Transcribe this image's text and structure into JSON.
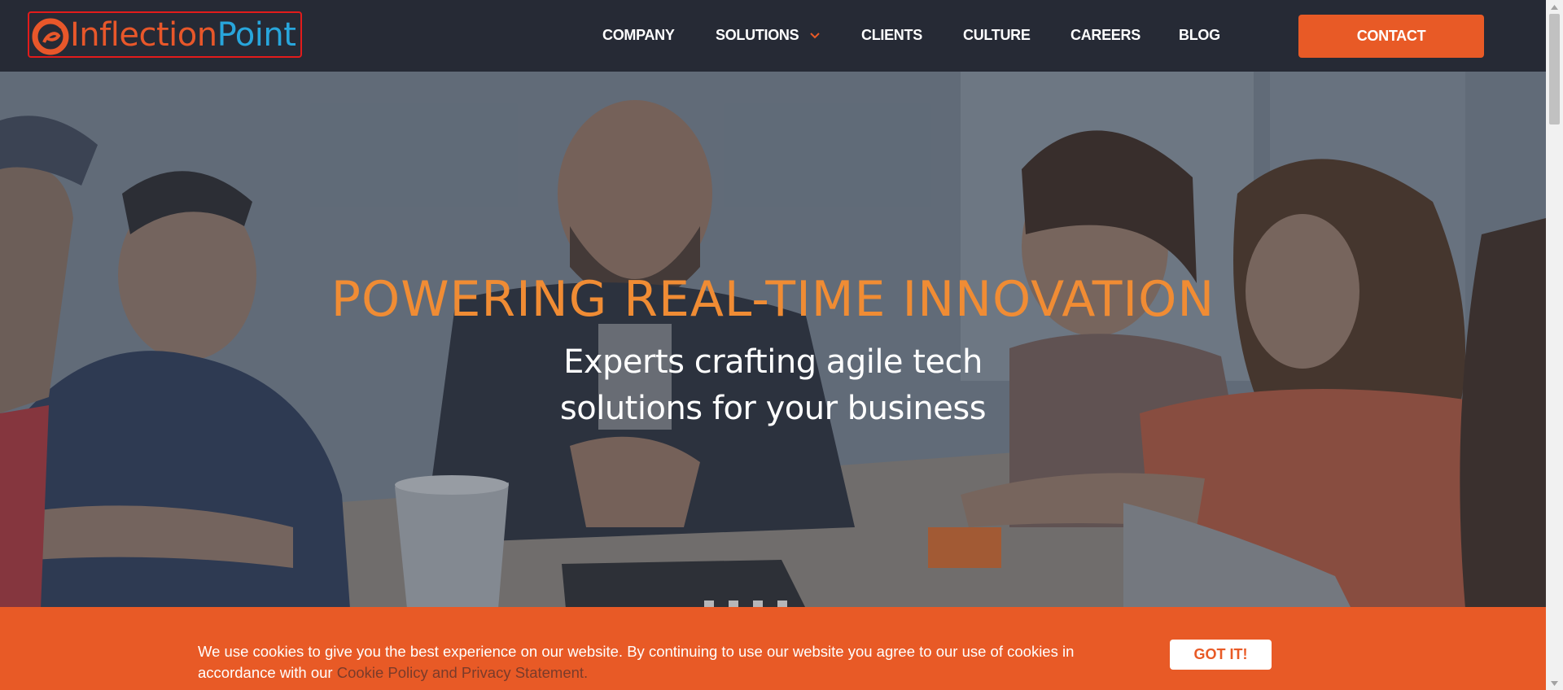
{
  "logo": {
    "word1": "Inflection",
    "word2": "Point",
    "icon": "inflection-point-logo-icon",
    "color_orange": "#e8572a",
    "color_blue": "#28a6dc"
  },
  "nav": {
    "items": [
      {
        "label": "COMPANY"
      },
      {
        "label": "SOLUTIONS",
        "icon": "chevron-down-icon"
      },
      {
        "label": "CLIENTS"
      },
      {
        "label": "CULTURE"
      },
      {
        "label": "CAREERS"
      },
      {
        "label": "BLOG"
      }
    ],
    "contact_label": "CONTACT"
  },
  "hero": {
    "title": "POWERING REAL-TIME INNOVATION",
    "subtitle_line1": "Experts crafting agile tech",
    "subtitle_line2": "solutions for your business",
    "slide_count": 4
  },
  "cookie": {
    "text": "We use cookies to give you the best experience on our website. By continuing to use our website you agree to our use of cookies in accordance with our ",
    "link_label": "Cookie Policy and Privacy Statement.",
    "button_label": "GOT IT!"
  },
  "colors": {
    "header_bg": "#262a35",
    "accent": "#e85a26",
    "hero_title": "#f08c34"
  }
}
